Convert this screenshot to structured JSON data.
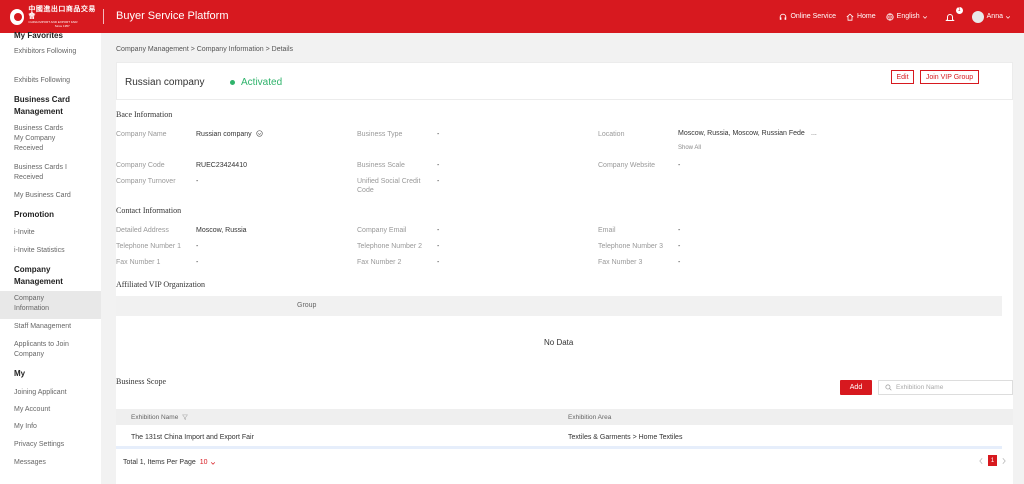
{
  "header": {
    "logo": {
      "line1": "中國進出口商品交易會",
      "line2": "CHINA IMPORT AND EXPORT FAIR",
      "line3": "Since 1957"
    },
    "title": "Buyer Service Platform",
    "online_service": "Online Service",
    "home": "Home",
    "language": "English",
    "notification_count": "1",
    "user": "Anna"
  },
  "sidebar": {
    "my_favorites": "My Favorites",
    "exhibitors_following": "Exhibitors Following",
    "exhibits_following": "Exhibits Following",
    "business_card_management": "Business Card Management",
    "business_cards_received": "Business Cards My Company Received",
    "business_cards_i_received": "Business Cards I Received",
    "my_business_card": "My Business Card",
    "promotion": "Promotion",
    "i_invite": "i-Invite",
    "i_invite_statistics": "i-Invite Statistics",
    "company_management": "Company Management",
    "company_information": "Company Information",
    "staff_management": "Staff Management",
    "applicants_to_join": "Applicants to Join Company",
    "my": "My",
    "joining_applicant": "Joining Applicant",
    "my_account": "My Account",
    "my_info": "My Info",
    "privacy_settings": "Privacy Settings",
    "messages": "Messages"
  },
  "breadcrumb": "Company Management > Company Information > Details",
  "company": {
    "name": "Russian company",
    "status": "Activated",
    "edit_label": "Edit",
    "join_vip_label": "Join VIP Group"
  },
  "basic_info": {
    "title": "Bace Information",
    "company_name_label": "Company Name",
    "company_name_value": "Russian company",
    "business_type_label": "Business Type",
    "business_type_value": "-",
    "location_label": "Location",
    "location_value": "Moscow, Russia, Moscow, Russian Fede",
    "location_ellipsis": "...",
    "show_all": "Show All",
    "company_code_label": "Company Code",
    "company_code_value": "RUEC23424410",
    "business_scale_label": "Business Scale",
    "business_scale_value": "-",
    "company_website_label": "Company Website",
    "company_website_value": "-",
    "company_turnover_label": "Company Turnover",
    "company_turnover_value": "-",
    "unified_code_label": "Unified Social Credit Code",
    "unified_code_value": "-"
  },
  "contact_info": {
    "title": "Contact Information",
    "detailed_address_label": "Detailed Address",
    "detailed_address_value": "Moscow, Russia",
    "company_email_label": "Company Email",
    "company_email_value": "-",
    "email_label": "Email",
    "email_value": "-",
    "tel1_label": "Telephone Number 1",
    "tel1_value": "-",
    "tel2_label": "Telephone Number 2",
    "tel2_value": "-",
    "tel3_label": "Telephone Number 3",
    "tel3_value": "-",
    "fax1_label": "Fax Number 1",
    "fax1_value": "-",
    "fax2_label": "Fax Number 2",
    "fax2_value": "-",
    "fax3_label": "Fax Number 3",
    "fax3_value": "-"
  },
  "vip": {
    "title": "Affiliated VIP Organization",
    "column_group": "Group",
    "no_data": "No Data"
  },
  "business_scope": {
    "title": "Business Scope",
    "add_label": "Add",
    "search_placeholder": "Exhibition Name",
    "columns": {
      "exhibition_name": "Exhibition Name",
      "exhibition_area": "Exhibition Area"
    },
    "rows": [
      {
        "exhibition_name": "The 131st China Import and Export Fair",
        "exhibition_area": "Textiles & Garments > Home Textiles"
      }
    ],
    "total_label": "Total 1, Items Per Page",
    "per_page": "10",
    "current_page": "1"
  },
  "colors": {
    "brand": "#d7191f",
    "status_active": "#2fb36b"
  }
}
